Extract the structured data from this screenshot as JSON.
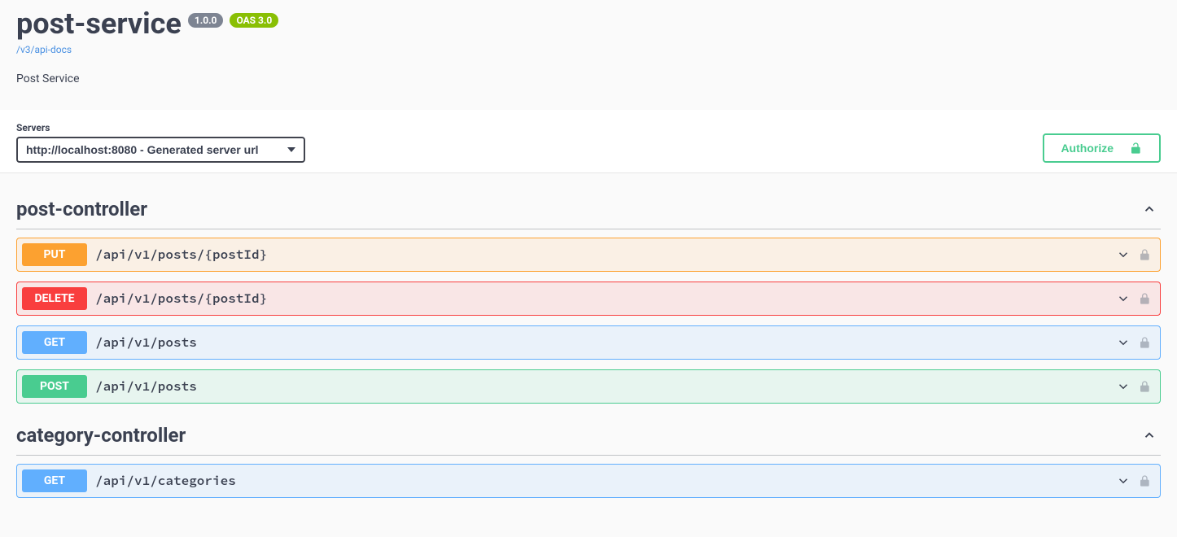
{
  "header": {
    "title": "post-service",
    "version": "1.0.0",
    "oas": "OAS 3.0",
    "docs_link": "/v3/api-docs",
    "description": "Post Service"
  },
  "servers": {
    "label": "Servers",
    "selected": "http://localhost:8080 - Generated server url"
  },
  "authorize": {
    "label": "Authorize"
  },
  "tags": [
    {
      "name": "post-controller",
      "operations": [
        {
          "method": "PUT",
          "path": "/api/v1/posts/{postId}"
        },
        {
          "method": "DELETE",
          "path": "/api/v1/posts/{postId}"
        },
        {
          "method": "GET",
          "path": "/api/v1/posts"
        },
        {
          "method": "POST",
          "path": "/api/v1/posts"
        }
      ]
    },
    {
      "name": "category-controller",
      "operations": [
        {
          "method": "GET",
          "path": "/api/v1/categories"
        }
      ]
    }
  ]
}
